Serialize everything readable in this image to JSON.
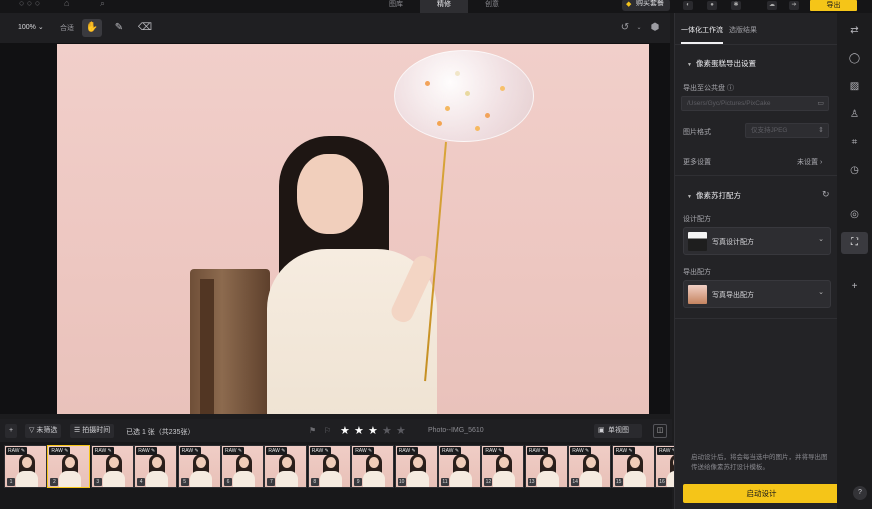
{
  "app": {
    "tabs": [
      {
        "label": "图库"
      },
      {
        "label": "精修"
      },
      {
        "label": "创意"
      }
    ],
    "buy_label": "购买套餐",
    "export_label": "导出"
  },
  "toolbar": {
    "zoom": "100%",
    "fit": "合适"
  },
  "filter": {
    "unfiltered": "未筛选",
    "sort": "拍摄时间",
    "selected": "已选 1 张（共235张）",
    "filename": "Photo--IMG_5610",
    "rating": 3,
    "single_view": "单视图"
  },
  "filmstrip": {
    "badge": "RAW",
    "selected_index": 2,
    "numbers": [
      "1",
      "2",
      "3",
      "4",
      "5",
      "6",
      "7",
      "8",
      "9",
      "10",
      "11",
      "12",
      "13",
      "14",
      "15",
      "16"
    ]
  },
  "panel": {
    "tabs": [
      {
        "label": "一体化工作流"
      },
      {
        "label": "选版结果"
      }
    ],
    "section1": {
      "title": "像素蛋糕导出设置",
      "export_label": "导出至公共盘",
      "export_path": "/Users/Gyc/Pictures/PixCake",
      "format_label": "图片格式",
      "format_value": "仅支持JPEG",
      "more_label": "更多设置",
      "more_value": "未设置"
    },
    "section2": {
      "title": "像素苏打配方",
      "design_label": "设计配方",
      "design_value": "写真设计配方",
      "export_label": "导出配方",
      "export_value": "写真导出配方"
    },
    "hint": "启动设计后，将会每当选中的图片，并将导出图传送给像素苏打设计模板。",
    "start_label": "启动设计"
  },
  "colors": {
    "accent": "#f5c518",
    "background": "#1c1c1e",
    "panel": "#232326"
  }
}
